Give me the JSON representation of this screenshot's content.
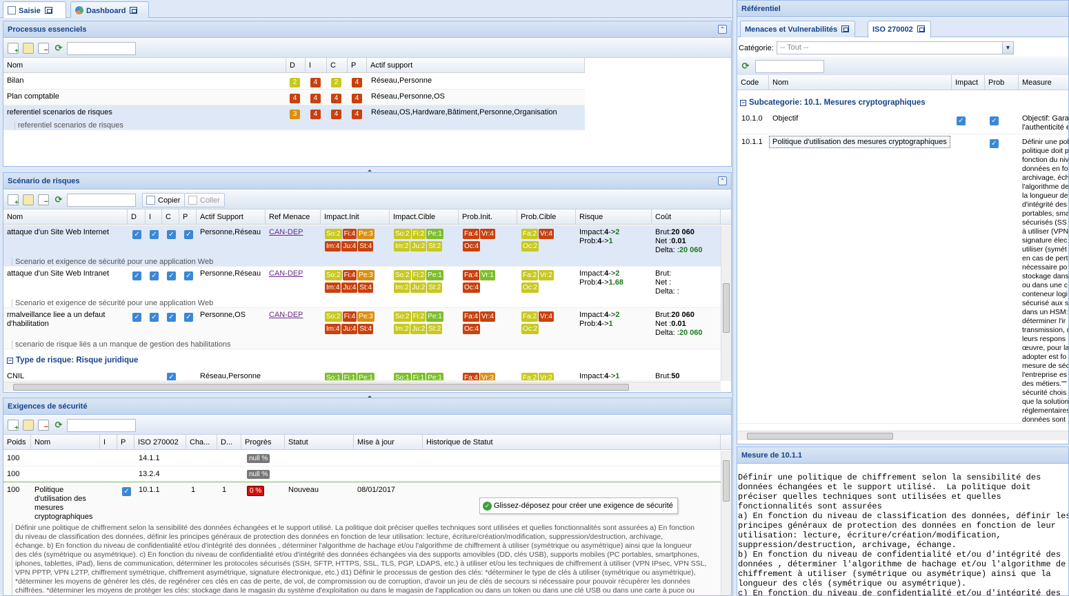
{
  "tabs": [
    {
      "label": "Saisie",
      "icon": "form-icon"
    },
    {
      "label": "Dashboard",
      "icon": "chart-pie-icon"
    }
  ],
  "processus": {
    "title": "Processus essenciels",
    "columns": [
      "Nom",
      "D",
      "I",
      "C",
      "P",
      "Actif support"
    ],
    "rows": [
      {
        "nom": "Bilan",
        "d": "2",
        "i": "4",
        "c": "2",
        "p": "4",
        "actif": "Réseau,Personne"
      },
      {
        "nom": "Plan comptable",
        "d": "4",
        "i": "4",
        "c": "4",
        "p": "4",
        "actif": "Réseau,Personne,OS"
      },
      {
        "nom": "referentiel scenarios de risques",
        "d": "3",
        "i": "4",
        "c": "4",
        "p": "4",
        "actif": "Réseau,OS,Hardware,Bâtiment,Personne,Organisation",
        "desc": "referentiel scenarios de risques"
      }
    ]
  },
  "scenario": {
    "title": "Scénario de risques",
    "copy_label": "Copier",
    "paste_label": "Coller",
    "columns": [
      "Nom",
      "D",
      "I",
      "C",
      "P",
      "Actif Support",
      "Ref Menace",
      "Impact.Init",
      "Impact.Cible",
      "Prob.Init.",
      "Prob.Cible",
      "Risque",
      "Coût"
    ],
    "rows": [
      {
        "nom": "attaque d'un Site Web Internet",
        "actif": "Personne,Réseau",
        "ref": "CAN-DEP",
        "init": [
          "So:2",
          "Fi:4",
          "Pe:3",
          "Im:4",
          "Ju:4",
          "St:4"
        ],
        "cible": [
          "So:2",
          "Fi:2",
          "Pe:1",
          "Im:2",
          "Ju:2",
          "St:2"
        ],
        "pinit": [
          "Fa:4",
          "Vr:4",
          "Oc:4"
        ],
        "pcible": [
          "Fa:2",
          "Vr:4",
          "Oc:2"
        ],
        "risque_impact": "Impact:",
        "ri_from": "4",
        "ri_to": "2",
        "risque_prob": "Prob:",
        "rp_from": "4",
        "rp_to": "1",
        "brut_label": "Brut:",
        "brut": "20 060",
        "net_label": "Net :",
        "net": "0.01",
        "delta_label": "Delta: :",
        "delta": "20 060",
        "desc": "Scenario et exigence de sécurité pour une application Web"
      },
      {
        "nom": "attaque d'un Site Web Intranet",
        "actif": "Personne,Réseau",
        "ref": "CAN-DEP",
        "init": [
          "So:2",
          "Fi:4",
          "Pe:3",
          "Im:4",
          "Ju:4",
          "St:4"
        ],
        "cible": [
          "So:2",
          "Fi:2",
          "Pe:1",
          "Im:2",
          "Ju:2",
          "St:2"
        ],
        "pinit": [
          "Fa:4",
          "Vr:1",
          "Oc:4"
        ],
        "pcible": [
          "Fa:2",
          "Vr:2",
          "Oc:2"
        ],
        "risque_impact": "Impact:",
        "ri_from": "4",
        "ri_to": "2",
        "risque_prob": "Prob:",
        "rp_from": "4",
        "rp_to": "1.68",
        "brut_label": "Brut:",
        "brut": "",
        "net_label": "Net :",
        "net": "",
        "delta_label": "Delta: :",
        "delta": "",
        "desc": "Scenario et exigence de sécurité pour une application Web"
      },
      {
        "nom": "rmalveillance liee a un defaut",
        "nom2": "d'habilitation",
        "actif": "Personne,OS",
        "ref": "CAN-DEP",
        "init": [
          "So:2",
          "Fi:4",
          "Pe:3",
          "Im:4",
          "Ju:4",
          "St:4"
        ],
        "cible": [
          "So:2",
          "Fi:2",
          "Pe:1",
          "Im:2",
          "Ju:2",
          "St:2"
        ],
        "pinit": [
          "Fa:4",
          "Vr:4",
          "Oc:4"
        ],
        "pcible": [
          "Fa:2",
          "Vr:4",
          "Oc:2"
        ],
        "risque_impact": "Impact:",
        "ri_from": "4",
        "ri_to": "2",
        "risque_prob": "Prob:",
        "rp_from": "4",
        "rp_to": "1",
        "brut_label": "Brut:",
        "brut": "20 060",
        "net_label": "Net :",
        "net": "0.01",
        "delta_label": "Delta: :",
        "delta": "20 060",
        "desc": "scenario de risque liés a un manque de gestion des habilitations"
      }
    ],
    "group_label": "Type de risque: Risque juridique",
    "last_row": {
      "nom": "CNIL",
      "actif": "Réseau,Personne",
      "init": [
        "So:1",
        "Fi:1",
        "Pe:1"
      ],
      "cible": [
        "So:1",
        "Fi:1",
        "Pe:1"
      ],
      "pinit": [
        "Fa:4",
        "Vr:3"
      ],
      "pcible": [
        "Fa:2",
        "Vr:2"
      ],
      "risque": "Impact:",
      "r_from": "4",
      "r_to": "1",
      "brut_label": "Brut:",
      "brut": "50"
    }
  },
  "exigences": {
    "title": "Exigences de sécurité",
    "columns": [
      "Poids",
      "Nom",
      "I",
      "P",
      "ISO 270002",
      "Cha...",
      "D...",
      "Progrès",
      "Statut",
      "Mise à jour",
      "Historique de Statut"
    ],
    "rows": [
      {
        "poids": "100",
        "iso": "14.1.1",
        "progres": "null %"
      },
      {
        "poids": "100",
        "iso": "13.2.4",
        "progres": "null %"
      },
      {
        "poids": "100",
        "nom": [
          "Politique",
          "d'utilisation des",
          "mesures",
          "cryptographiques"
        ],
        "iso": "10.1.1",
        "cha": "1",
        "d": "1",
        "progres": "0 %",
        "statut": "Nouveau",
        "maj": "08/01/2017"
      }
    ],
    "drop_hint": "Glissez-déposez pour créer une exigence de sécurité",
    "description_lines": [
      "Définir une politique de chiffrement selon la sensibilité des données échangées et le support utilisé. La politique doit préciser quelles techniques sont utilisées et quelles fonctionnalités sont assurées a) En fonction",
      "du niveau de classification des données, définir les principes généraux de protection des données en fonction de leur utilisation: lecture, écriture/création/modification, suppression/destruction, archivage,",
      "échange. b) En fonction du niveau de confidentialité et/ou d'intégrité des données , déterminer l'algorithme de hachage et/ou l'algorithme de chiffrement à utiliser (symétrique ou asymétrique) ainsi que la longueur",
      "des clés (symétrique ou asymétrique). c) En fonction du niveau de confidentialité et/ou d'intégrité des données échangées via des supports amovibles (DD, clés USB), supports mobiles (PC portables, smartphones,",
      "iphones, tablettes, iPad), liens de communication, déterminer les protocoles sécurisés (SSH, SFTP, HTTPS, SSL, TLS, PGP, LDAPS, etc.) à utiliser et/ou les techniques de chiffrement à utiliser (VPN IPsec, VPN SSL,",
      "VPN PPTP, VPN L2TP, chiffrement symétrique, chiffrement asymétrique, signature électronique, etc.) d1) Définir le processus de gestion des clés: *déterminer le type de clés à utiliser (symétrique ou asymétrique),",
      "*déterminer les moyens de générer les clés, de regénérer ces clés en cas de perte, de vol, de compromission ou de corruption, d'avoir un jeu de clés de secours si nécessaire pour pouvoir récupérer les données",
      "chiffrées. *déterminer les moyens de protéger les clés: stockage dans le magasin du système d'exploitation ou dans le magasin de l'application ou dans un token ou dans une clé USB ou dans une carte à puce ou"
    ]
  },
  "referentiel": {
    "title": "Référentiel",
    "tabs": [
      "Menaces et Vulnerabilités",
      "ISO 270002"
    ],
    "categorie_label": "Catégorie:",
    "categorie_value": "-- Tout --",
    "columns": [
      "Code",
      "Nom",
      "Impact",
      "Prob",
      "Measure"
    ],
    "group_label": "Subcategorie: 10.1. Mesures cryptographiques",
    "rows": [
      {
        "code": "10.1.0",
        "nom": "Objectif",
        "measure": [
          "Objectif: Garan",
          "l'authenticité e"
        ]
      },
      {
        "code": "10.1.1",
        "nom": "Politique d'utilisation des mesures cryptographiques",
        "measure": [
          "Définir une poli",
          "politique doit p",
          "fonction du niv",
          "données en fo",
          "archivage, éch",
          "l'algorithme de",
          "la longueur de",
          "d'intégrité des",
          "portables, sma",
          "sécurisés (SS",
          "à utiliser (VPN",
          "signature élec",
          "utiliser (symét",
          "en cas de pert",
          "nécessaire po",
          "stockage dans",
          "ou dans une c",
          "conteneur logi",
          "sécurisé aux s",
          "dans un HSM:",
          "déterminer l'ir",
          "transmission, d",
          "leurs respons",
          "œuvre, pour la",
          "adopter est fo",
          "mesure de séc",
          "l'entreprise es",
          "des métiers.\"\"",
          "sécurité chois",
          "que la solution",
          "réglementaires",
          "données sont"
        ]
      }
    ]
  },
  "mesure": {
    "title": "Mesure de 10.1.1",
    "lines": [
      "Définir une politique de chiffrement selon la sensibilité des",
      "données échangées et le support utilisé.  La politique doit",
      "préciser quelles techniques sont utilisées et quelles",
      "fonctionnalités sont assurées",
      "a) En fonction du niveau de classification des données, définir les",
      "principes généraux de protection des données en fonction de leur",
      "utilisation: lecture, écriture/création/modification,",
      "suppression/destruction, archivage, échange.",
      "b) En fonction du niveau de confidentialité et/ou d'intégrité des",
      "données , déterminer l'algorithme de hachage et/ou l'algorithme de",
      "chiffrement à utiliser (symétrique ou asymétrique) ainsi que la",
      "longueur des clés (symétrique ou asymétrique).",
      "c) En fonction du niveau de confidentialité et/ou d'intégrité des"
    ]
  }
}
